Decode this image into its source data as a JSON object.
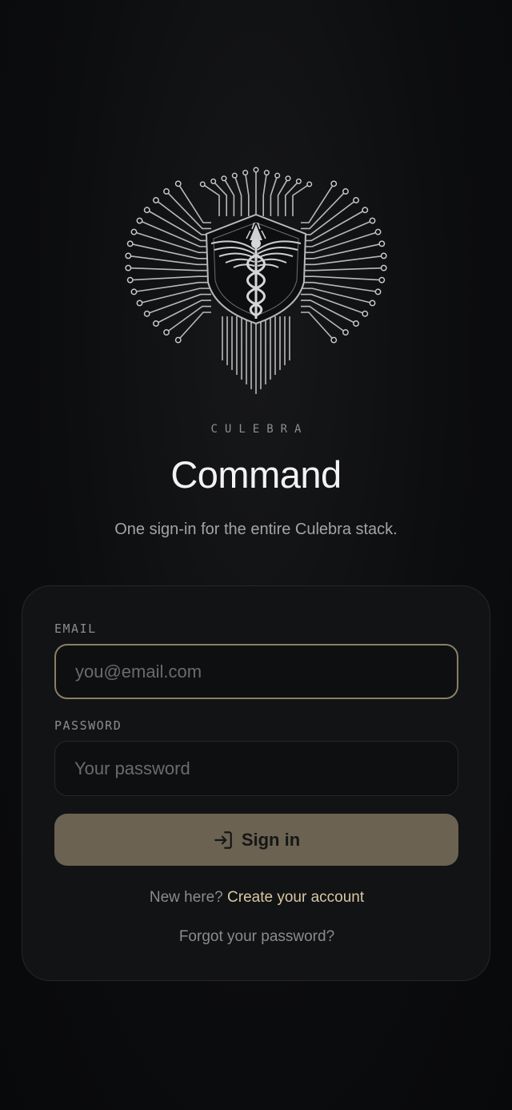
{
  "brand": {
    "wordmark": "CULEBRA"
  },
  "header": {
    "title": "Command",
    "subtitle": "One sign-in for the entire Culebra stack."
  },
  "form": {
    "email": {
      "label": "EMAIL",
      "placeholder": "you@email.com",
      "value": ""
    },
    "password": {
      "label": "PASSWORD",
      "placeholder": "Your password",
      "value": ""
    },
    "submit_label": "Sign in",
    "new_here_text": "New here?",
    "create_account_label": "Create your account",
    "forgot_password_label": "Forgot your password?"
  },
  "icons": {
    "logo": "circuit-shield-caduceus-icon",
    "submit": "sign-in-arrow-icon"
  },
  "colors": {
    "background": "#0a0b0c",
    "card": "#121315",
    "accent": "#6b6252",
    "accent_text": "#d8c7a2",
    "focus_border": "#8a7f67"
  }
}
